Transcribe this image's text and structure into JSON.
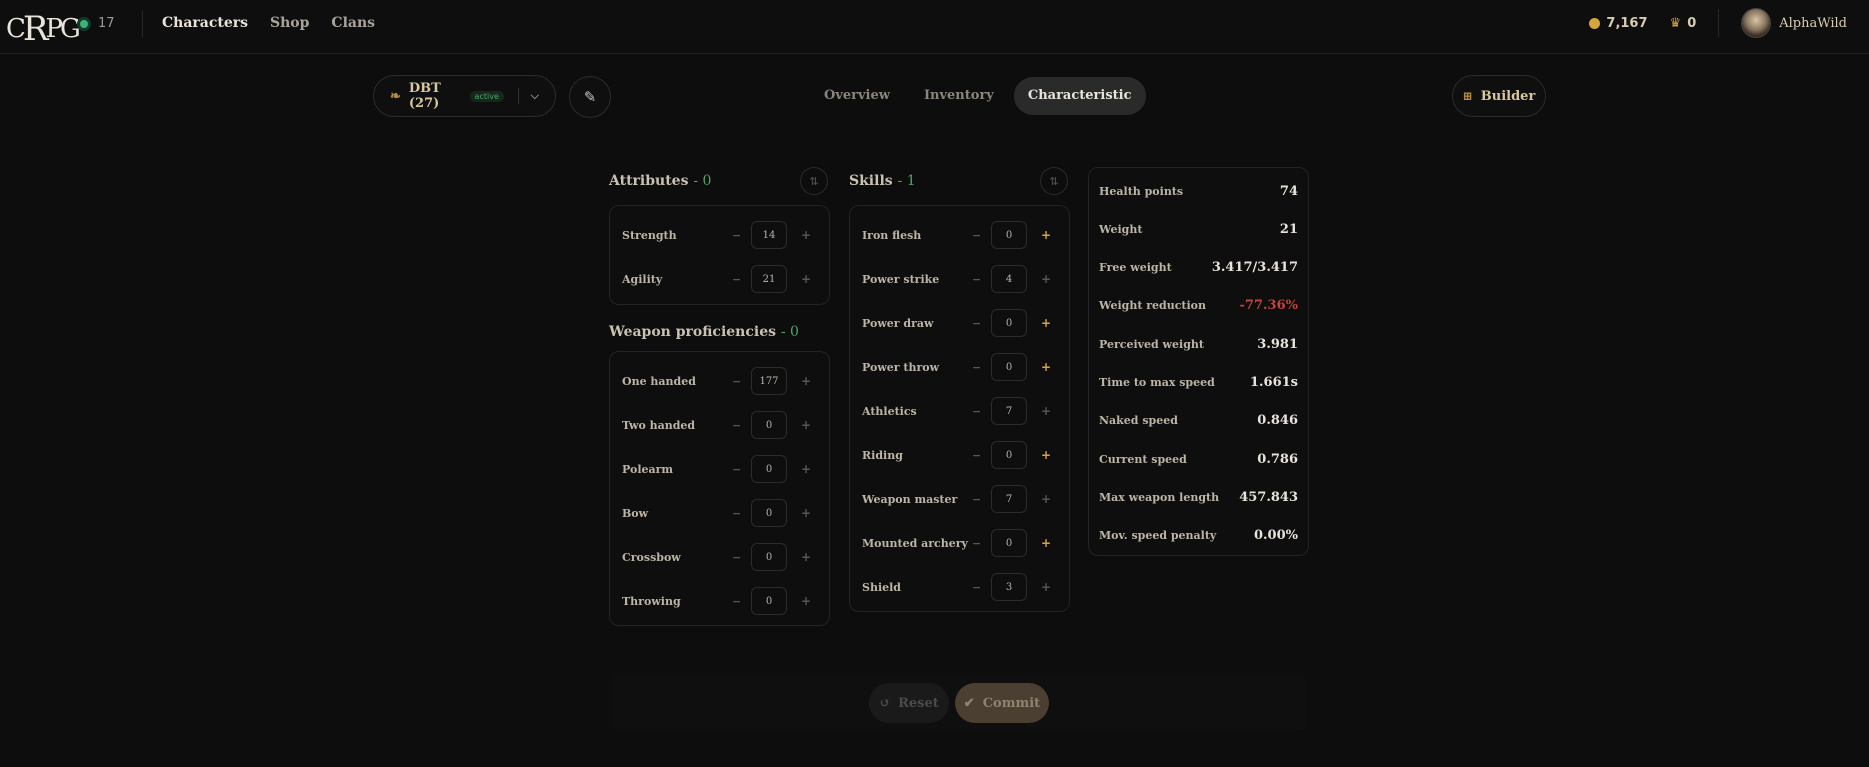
{
  "topbar": {
    "logo": {
      "c": "C",
      "r": "R",
      "pg": "PG"
    },
    "online_count": "17",
    "nav": [
      "Characters",
      "Shop",
      "Clans"
    ],
    "gold": "7,167",
    "heirlooms": "0",
    "username": "AlphaWild"
  },
  "character": {
    "name": "DBT (27)",
    "badge": "active"
  },
  "tabs": [
    "Overview",
    "Inventory",
    "Characteristic"
  ],
  "builder_label": "Builder",
  "attributes": {
    "title": "Attributes",
    "points": "- 0",
    "items": [
      {
        "label": "Strength",
        "value": "14"
      },
      {
        "label": "Agility",
        "value": "21"
      }
    ]
  },
  "weapon_proficiencies": {
    "title": "Weapon proficiencies",
    "points": "- 0",
    "items": [
      {
        "label": "One handed",
        "value": "177"
      },
      {
        "label": "Two handed",
        "value": "0"
      },
      {
        "label": "Polearm",
        "value": "0"
      },
      {
        "label": "Bow",
        "value": "0"
      },
      {
        "label": "Crossbow",
        "value": "0"
      },
      {
        "label": "Throwing",
        "value": "0"
      }
    ]
  },
  "skills": {
    "title": "Skills",
    "points": "- 1",
    "items": [
      {
        "label": "Iron flesh",
        "value": "0"
      },
      {
        "label": "Power strike",
        "value": "4"
      },
      {
        "label": "Power draw",
        "value": "0"
      },
      {
        "label": "Power throw",
        "value": "0"
      },
      {
        "label": "Athletics",
        "value": "7"
      },
      {
        "label": "Riding",
        "value": "0"
      },
      {
        "label": "Weapon master",
        "value": "7"
      },
      {
        "label": "Mounted archery",
        "value": "0"
      },
      {
        "label": "Shield",
        "value": "3"
      }
    ]
  },
  "stats": [
    {
      "label": "Health points",
      "value": "74"
    },
    {
      "label": "Weight",
      "value": "21"
    },
    {
      "label": "Free weight",
      "value": "3.417/3.417"
    },
    {
      "label": "Weight reduction",
      "value": "-77.36%"
    },
    {
      "label": "Perceived weight",
      "value": "3.981"
    },
    {
      "label": "Time to max speed",
      "value": "1.661s"
    },
    {
      "label": "Naked speed",
      "value": "0.846"
    },
    {
      "label": "Current speed",
      "value": "0.786"
    },
    {
      "label": "Max weapon length",
      "value": "457.843"
    },
    {
      "label": "Mov. speed penalty",
      "value": "0.00%"
    }
  ],
  "actions": {
    "reset": "Reset",
    "commit": "Commit"
  },
  "colors": {
    "accent": "#d4a53a",
    "positive": "#4fa56a",
    "negative": "#c0453d"
  }
}
